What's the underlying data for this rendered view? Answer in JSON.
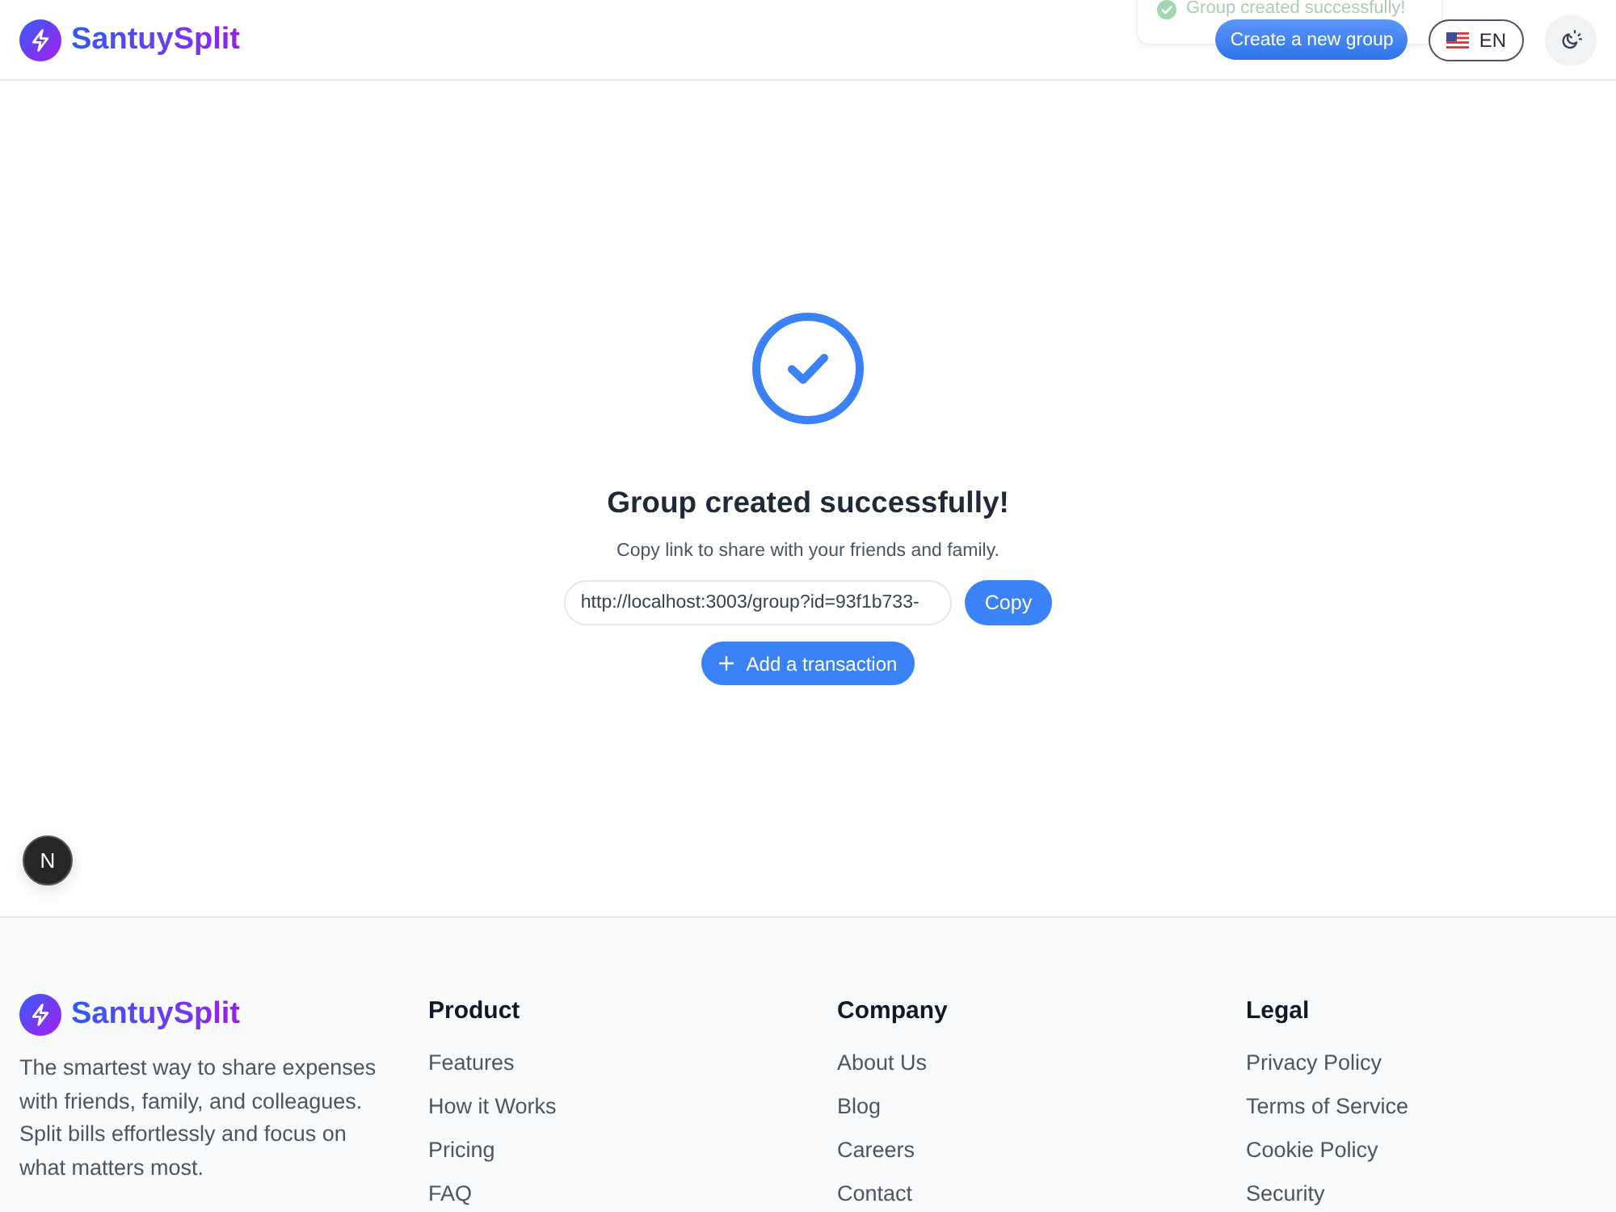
{
  "header": {
    "brand": "SantuySplit",
    "create_button": "Create a new group",
    "language": {
      "code": "EN"
    }
  },
  "toast": {
    "message": "Group created successfully!"
  },
  "success": {
    "title": "Group created successfully!",
    "subtitle": "Copy link to share with your friends and family.",
    "link": {
      "value": "http://localhost:3003/group?id=93f1b733-"
    },
    "copy_button": "Copy",
    "add_button": "Add a transaction"
  },
  "dev_badge": {
    "label": "N"
  },
  "footer": {
    "brand": "SantuySplit",
    "description": "The smartest way to share expenses with friends, family, and colleagues. Split bills effortlessly and focus on what matters most.",
    "columns": [
      {
        "heading": "Product",
        "links": [
          "Features",
          "How it Works",
          "Pricing",
          "FAQ"
        ]
      },
      {
        "heading": "Company",
        "links": [
          "About Us",
          "Blog",
          "Careers",
          "Contact"
        ]
      },
      {
        "heading": "Legal",
        "links": [
          "Privacy Policy",
          "Terms of Service",
          "Cookie Policy",
          "Security"
        ]
      }
    ]
  }
}
